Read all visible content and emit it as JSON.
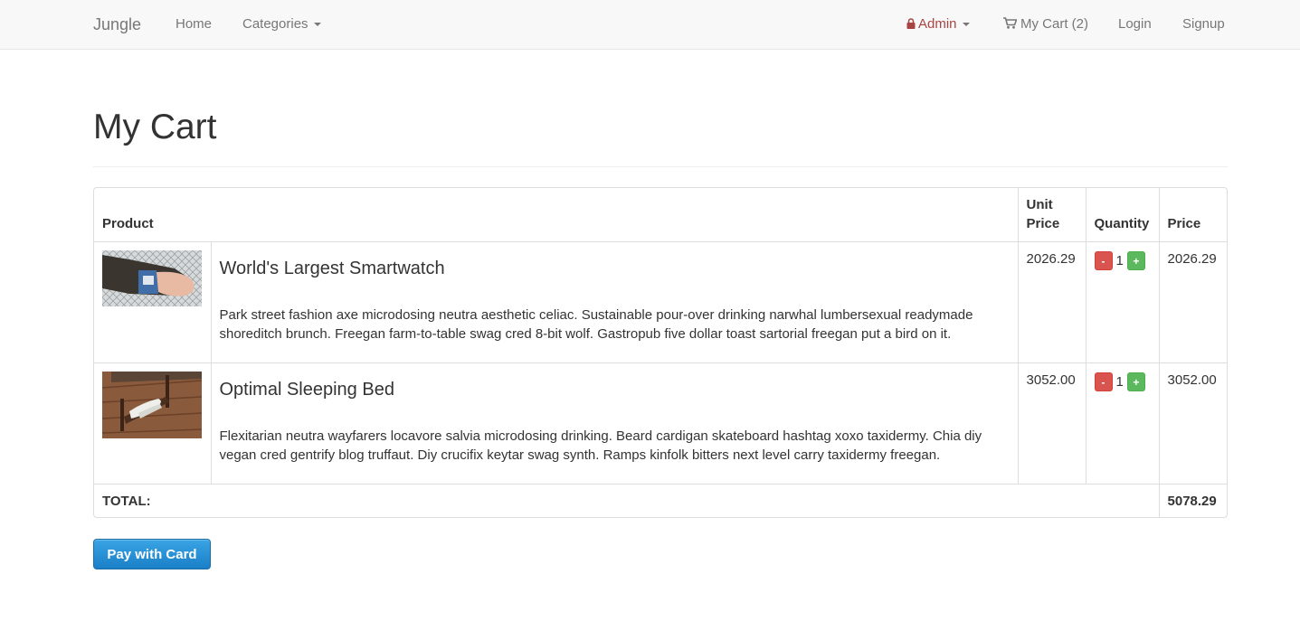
{
  "nav": {
    "brand": "Jungle",
    "home": "Home",
    "categories": "Categories",
    "admin": "Admin",
    "cart": "My Cart (2)",
    "login": "Login",
    "signup": "Signup"
  },
  "page": {
    "title": "My Cart"
  },
  "cart": {
    "headers": {
      "product": "Product",
      "unit_price": "Unit Price",
      "quantity": "Quantity",
      "price": "Price"
    },
    "items": [
      {
        "name": "World's Largest Smartwatch",
        "description": "Park street fashion axe microdosing neutra aesthetic celiac. Sustainable pour-over drinking narwhal lumbersexual readymade shoreditch brunch. Freegan farm-to-table swag cred 8-bit wolf. Gastropub five dollar toast sartorial freegan put a bird on it.",
        "unit_price": "2026.29",
        "quantity": "1",
        "price": "2026.29",
        "minus": "-",
        "plus": "+"
      },
      {
        "name": "Optimal Sleeping Bed",
        "description": "Flexitarian neutra wayfarers locavore salvia microdosing drinking. Beard cardigan skateboard hashtag xoxo taxidermy. Chia diy vegan cred gentrify blog truffaut. Diy crucifix keytar swag synth. Ramps kinfolk bitters next level carry taxidermy freegan.",
        "unit_price": "3052.00",
        "quantity": "1",
        "price": "3052.00",
        "minus": "-",
        "plus": "+"
      }
    ],
    "total_label": "TOTAL:",
    "total_value": "5078.29"
  },
  "checkout": {
    "pay_label": "Pay with Card"
  },
  "colors": {
    "admin": "#a94442",
    "minus_button": "#d9534f",
    "plus_button": "#5cb85c",
    "pay_button": "#2a93d8"
  },
  "icons": {
    "admin": "lock-icon",
    "cart": "shopping-cart-icon"
  }
}
